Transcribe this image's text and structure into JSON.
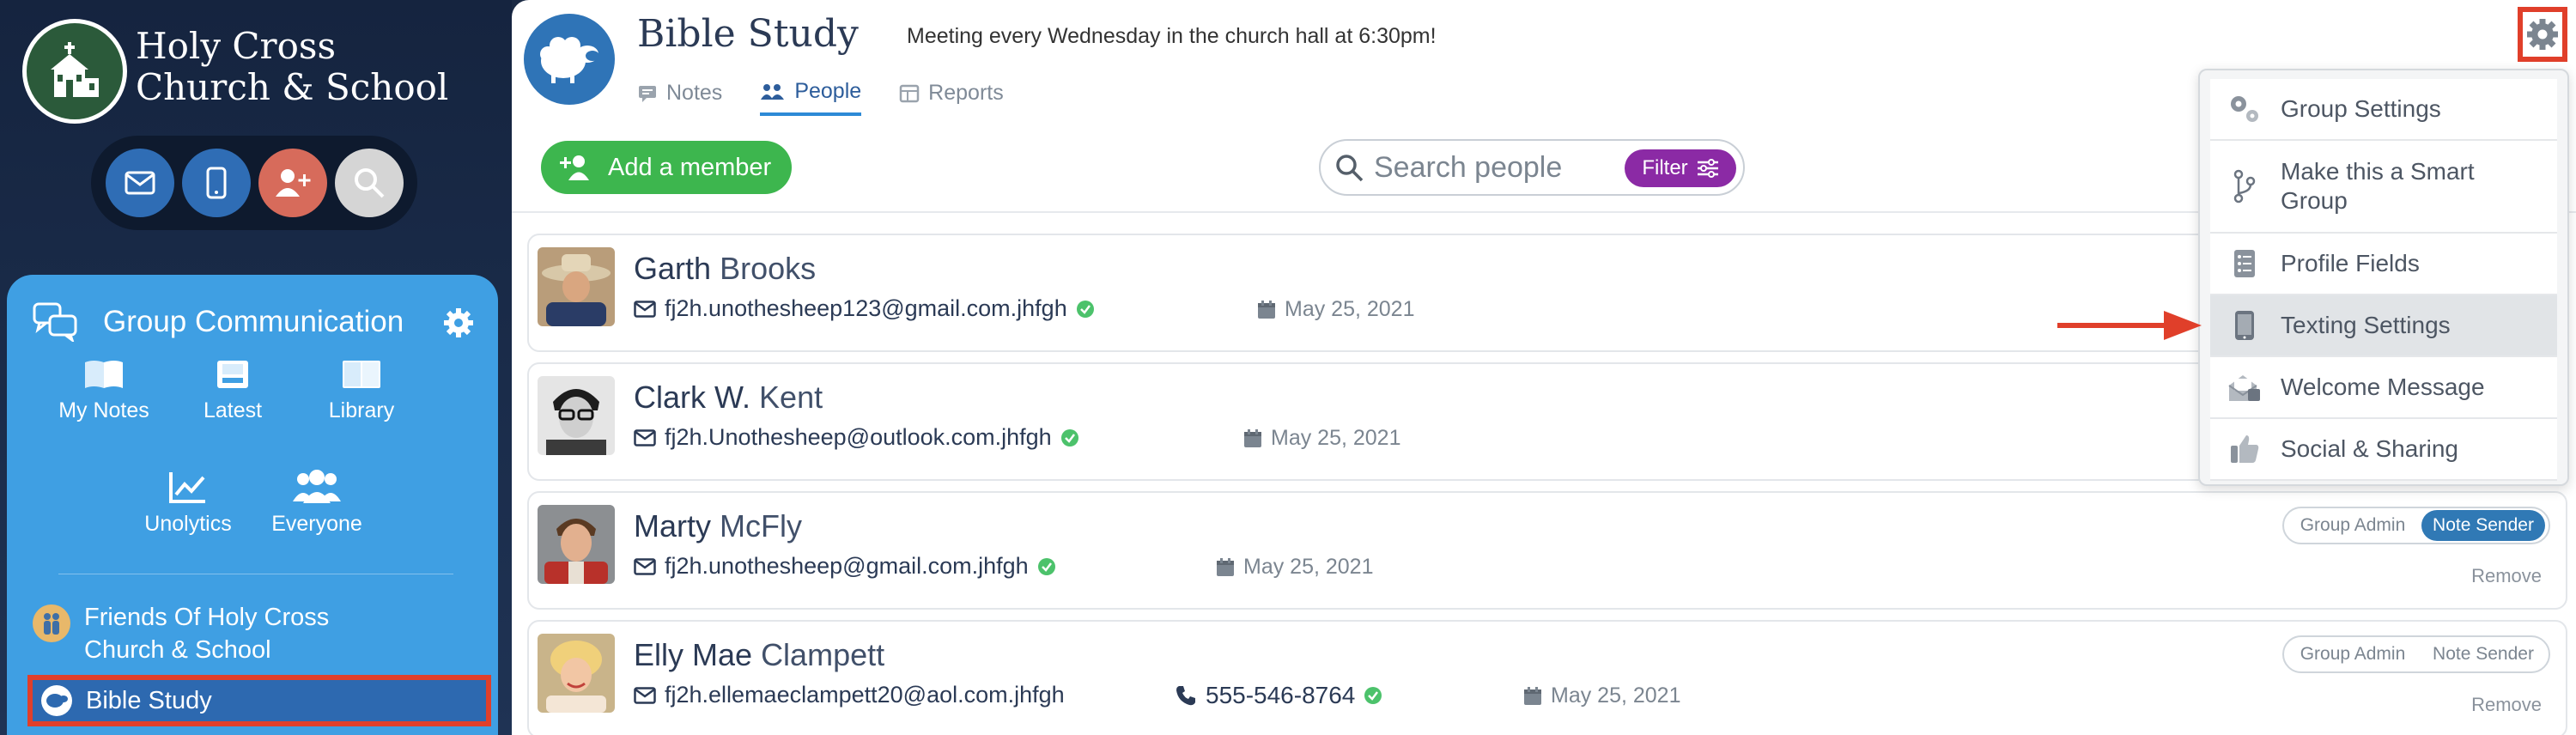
{
  "sidebar": {
    "church_name": "Holy Cross Church & School",
    "quick_actions": [
      {
        "icon": "mail-icon",
        "color": "#2f6db5"
      },
      {
        "icon": "mobile-icon",
        "color": "#2f6db5"
      },
      {
        "icon": "add-user-icon",
        "color": "#d76b5b"
      },
      {
        "icon": "search-icon",
        "color": "#d5d5d5"
      }
    ],
    "group_panel": {
      "title": "Group Communication",
      "tools": [
        {
          "label": "My Notes",
          "icon": "notes-icon"
        },
        {
          "label": "Latest",
          "icon": "inbox-icon"
        },
        {
          "label": "Library",
          "icon": "book-icon"
        },
        {
          "label": "Unolytics",
          "icon": "analytics-icon"
        },
        {
          "label": "Everyone",
          "icon": "people-icon"
        }
      ],
      "groups": [
        {
          "label": "Friends Of Holy Cross Church & School",
          "icon": "family-icon"
        },
        {
          "label": "Bible Study",
          "icon": "sheep-icon",
          "selected": true
        }
      ]
    }
  },
  "header": {
    "title": "Bible Study",
    "description": "Meeting every Wednesday in the church hall at 6:30pm!",
    "tabs": [
      {
        "label": "Notes",
        "active": false
      },
      {
        "label": "People",
        "active": true
      },
      {
        "label": "Reports",
        "active": false
      }
    ]
  },
  "toolbar": {
    "add_member_label": "Add a member",
    "search_placeholder": "Search people",
    "filter_label": "Filter"
  },
  "members": [
    {
      "first": "Garth",
      "last": "Brooks",
      "email": "fj2h.unothesheep123@gmail.com.jhfgh",
      "date": "May 25, 2021"
    },
    {
      "first": "Clark W.",
      "last": "Kent",
      "email": "fj2h.Unothesheep@outlook.com.jhfgh",
      "date": "May 25, 2021"
    },
    {
      "first": "Marty",
      "last": "McFly",
      "email": "fj2h.unothesheep@gmail.com.jhfgh",
      "date": "May 25, 2021",
      "role_admin": "Group Admin",
      "role_sender": "Note Sender",
      "remove": "Remove"
    },
    {
      "first": "Elly Mae",
      "last": "Clampett",
      "email": "fj2h.ellemaeclampett20@aol.com.jhfgh",
      "phone": "555-546-8764",
      "date": "May 25, 2021",
      "role_admin": "Group Admin",
      "role_sender": "Note Sender",
      "remove": "Remove"
    }
  ],
  "settings_menu": {
    "items": [
      {
        "label": "Group Settings",
        "icon": "gears-icon"
      },
      {
        "label": "Make this a Smart Group",
        "icon": "branch-icon"
      },
      {
        "label": "Profile Fields",
        "icon": "list-icon"
      },
      {
        "label": "Texting Settings",
        "icon": "phone-icon",
        "highlighted": true
      },
      {
        "label": "Welcome Message",
        "icon": "envelope-icon"
      },
      {
        "label": "Social & Sharing",
        "icon": "thumbs-up-icon"
      }
    ]
  },
  "colors": {
    "highlight_red": "#e03f2a",
    "sidebar_panel_blue": "#3f9fe3",
    "add_green": "#3db64e",
    "filter_purple": "#8b2aa5",
    "verified_green": "#4cc26b"
  }
}
